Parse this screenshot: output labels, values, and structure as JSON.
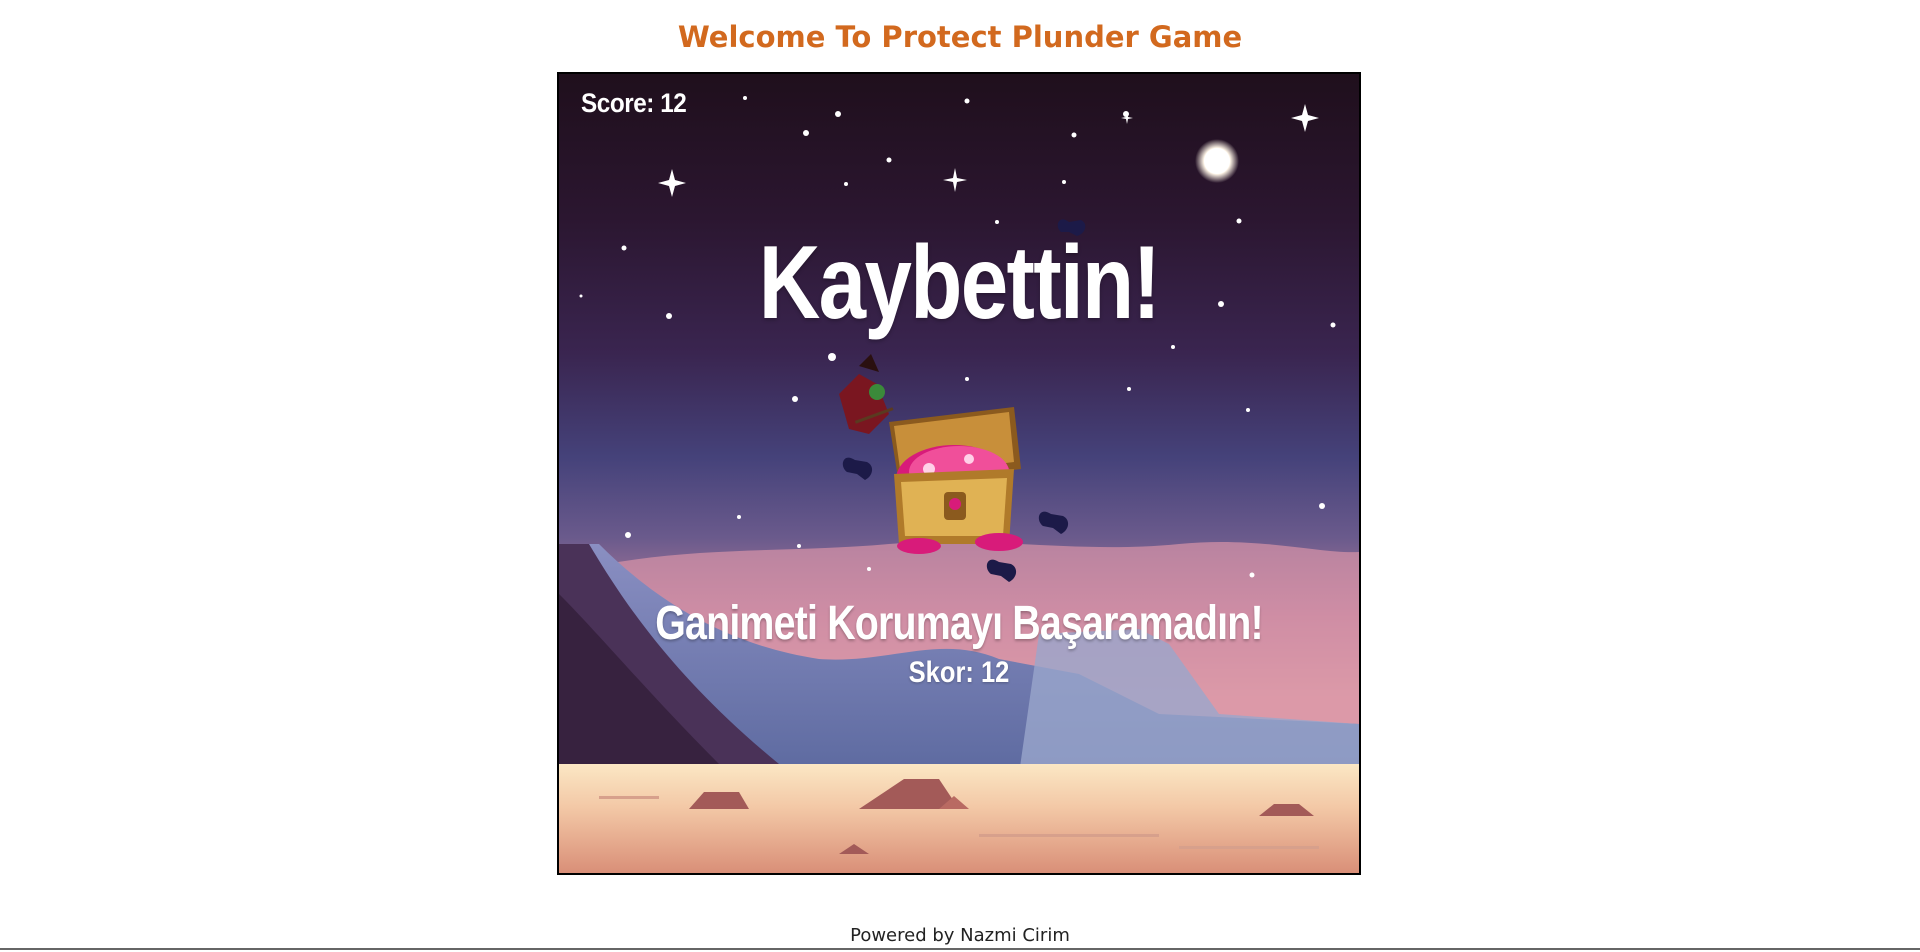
{
  "page": {
    "title": "Welcome To Protect Plunder Game",
    "footer": "Powered by Nazmi Cirim"
  },
  "game": {
    "hud_score": "Score: 12",
    "lose_title": "Kaybettin!",
    "lose_message": "Ganimeti Korumayı Başaramadın!",
    "lose_score": "Skor: 12",
    "score_value": 12,
    "sprites": [
      "night-sky-background",
      "moon",
      "stars",
      "desert-mountains",
      "desert-ground",
      "treasure-chest",
      "bat-enemies",
      "witch-enemy"
    ]
  },
  "colors": {
    "title": "#d2691e",
    "text_on_game": "#ffffff"
  }
}
